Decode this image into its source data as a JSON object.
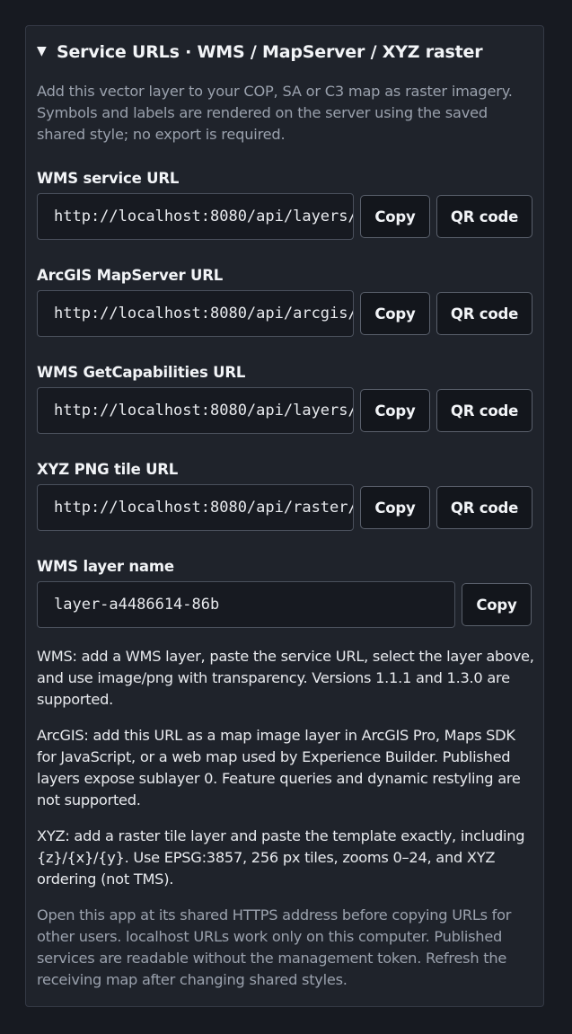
{
  "section": {
    "title": "Service URLs · WMS / MapServer / XYZ raster",
    "intro": "Add this vector layer to your COP, SA or C3 map as raster imagery. Symbols and labels are rendered on the server using the saved shared style; no export is required."
  },
  "fields": [
    {
      "label": "WMS service URL",
      "value": "http://localhost:8080/api/layers/",
      "copy": "Copy",
      "qr": "QR code"
    },
    {
      "label": "ArcGIS MapServer URL",
      "value": "http://localhost:8080/api/arcgis/",
      "copy": "Copy",
      "qr": "QR code"
    },
    {
      "label": "WMS GetCapabilities URL",
      "value": "http://localhost:8080/api/layers/",
      "copy": "Copy",
      "qr": "QR code"
    },
    {
      "label": "XYZ PNG tile URL",
      "value": "http://localhost:8080/api/raster/",
      "copy": "Copy",
      "qr": "QR code"
    }
  ],
  "layer_name": {
    "label": "WMS layer name",
    "value": "layer-a4486614-86b",
    "copy": "Copy"
  },
  "notes": {
    "wms": "WMS: add a WMS layer, paste the service URL, select the layer above, and use image/png with transparency. Versions 1.1.1 and 1.3.0 are supported.",
    "arcgis": "ArcGIS: add this URL as a map image layer in ArcGIS Pro, Maps SDK for JavaScript, or a web map used by Experience Builder. Published layers expose sublayer 0. Feature queries and dynamic restyling are not supported.",
    "xyz": "XYZ: add a raster tile layer and paste the template exactly, including {z}/{x}/{y}. Use EPSG:3857, 256 px tiles, zooms 0–24, and XYZ ordering (not TMS).",
    "footer": "Open this app at its shared HTTPS address before copying URLs for other users. localhost URLs work only on this computer. Published services are readable without the management token. Refresh the receiving map after changing shared styles."
  },
  "icons": {
    "expand": "triangle-down-icon"
  },
  "colors": {
    "background": "#171a21",
    "panel": "#1f232b",
    "muted_text": "#9aa1ad",
    "button_bg": "#13161c"
  }
}
